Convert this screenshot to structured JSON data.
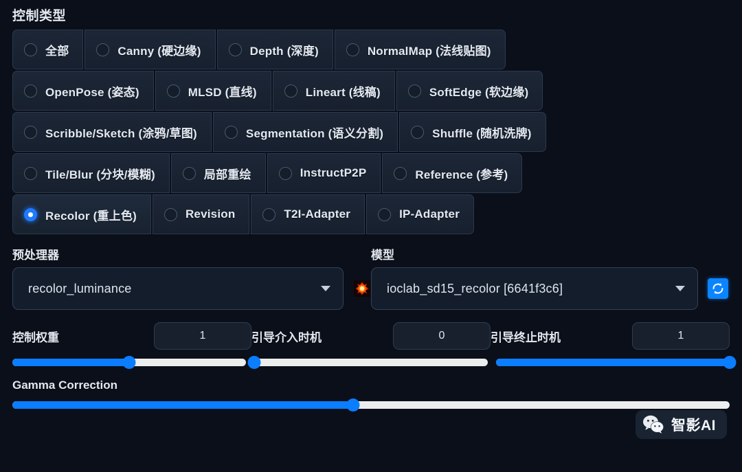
{
  "section": {
    "title": "控制类型"
  },
  "control_types": {
    "selected": "Recolor (重上色)",
    "rows": [
      [
        {
          "label": "全部",
          "selected": false
        },
        {
          "label": "Canny (硬边缘)",
          "selected": false
        },
        {
          "label": "Depth (深度)",
          "selected": false
        },
        {
          "label": "NormalMap (法线贴图)",
          "selected": false
        }
      ],
      [
        {
          "label": "OpenPose (姿态)",
          "selected": false
        },
        {
          "label": "MLSD (直线)",
          "selected": false
        },
        {
          "label": "Lineart (线稿)",
          "selected": false
        },
        {
          "label": "SoftEdge (软边缘)",
          "selected": false
        }
      ],
      [
        {
          "label": "Scribble/Sketch (涂鸦/草图)",
          "selected": false
        },
        {
          "label": "Segmentation (语义分割)",
          "selected": false
        },
        {
          "label": "Shuffle (随机洗牌)",
          "selected": false
        }
      ],
      [
        {
          "label": "Tile/Blur (分块/模糊)",
          "selected": false
        },
        {
          "label": "局部重绘",
          "selected": false
        },
        {
          "label": "InstructP2P",
          "selected": false
        },
        {
          "label": "Reference (参考)",
          "selected": false
        }
      ],
      [
        {
          "label": "Recolor (重上色)",
          "selected": true
        },
        {
          "label": "Revision",
          "selected": false
        },
        {
          "label": "T2I-Adapter",
          "selected": false
        },
        {
          "label": "IP-Adapter",
          "selected": false
        }
      ]
    ]
  },
  "preprocessor": {
    "label": "预处理器",
    "value": "recolor_luminance",
    "icon": "burst-icon"
  },
  "model": {
    "label": "模型",
    "value": "ioclab_sd15_recolor [6641f3c6]",
    "refresh_icon": "refresh-icon"
  },
  "sliders": [
    {
      "name": "控制权重",
      "value": "1",
      "percent": 50
    },
    {
      "name": "引导介入时机",
      "value": "0",
      "percent": 0
    },
    {
      "name": "引导终止时机",
      "value": "1",
      "percent": 100
    }
  ],
  "gamma": {
    "label": "Gamma Correction",
    "percent": 47.5
  },
  "watermark": {
    "text": "智影AI",
    "icon": "wechat-icon"
  },
  "colors": {
    "accent": "#0b7dff",
    "background": "#0b0f19",
    "panel": "#16202e",
    "border": "#2c3a4e",
    "track": "#eceded"
  }
}
